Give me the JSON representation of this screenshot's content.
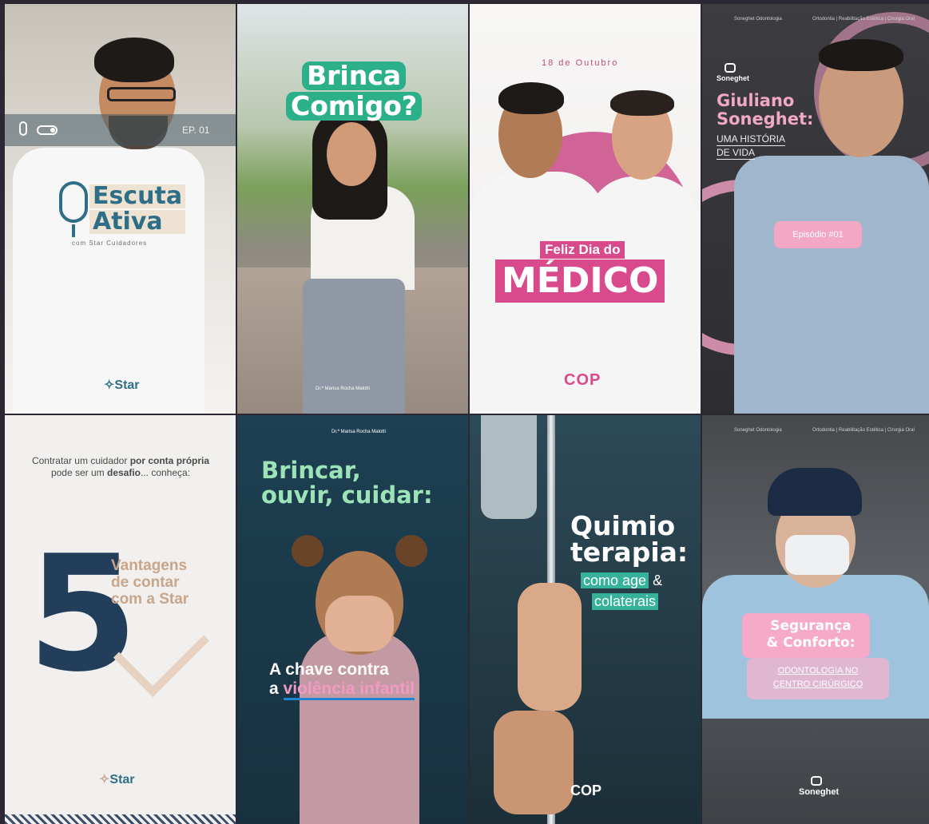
{
  "card1": {
    "ep": "EP. 01",
    "title_line1": "Escuta",
    "title_line2": "Ativa",
    "subtitle": "com Star Cuidadores",
    "logo": "Star"
  },
  "card2": {
    "title_line1": "Brinca",
    "title_line2": "Comigo?",
    "footer": "Dr.ª Marisa Rocha Malotti"
  },
  "card3": {
    "date": "18 de Outubro",
    "feliz": "Feliz Dia do",
    "medico": "MÉDICO",
    "logo": "COP"
  },
  "card4": {
    "nav_left": "Soneghet Odontologia",
    "nav_right": "Ortodontia | Reabilitação Estética | Cirurgia Oral",
    "brand": "Soneghet",
    "name_line1": "Giuliano",
    "name_line2": "Soneghet:",
    "hist_line1": "UMA HISTÓRIA",
    "hist_line2": "DE VIDA",
    "episode": "Episódio #01"
  },
  "card5": {
    "intro_part1": "Contratar um cuidador ",
    "intro_bold1": "por conta própria",
    "intro_part2": "pode ser um ",
    "intro_bold2": "desafio",
    "intro_part3": "... conheça:",
    "number": "5",
    "vant_line1": "Vantagens",
    "vant_line2": "de contar",
    "vant_line3": "com a Star",
    "logo": "Star"
  },
  "card6": {
    "header": "Dr.ª Marisa Rocha Malotti",
    "title_line1": "Brincar,",
    "title_line2": "ouvir, cuidar:",
    "chave_line1": "A chave contra",
    "chave_a": "a ",
    "chave_pink": "violência infantil"
  },
  "card7": {
    "title_line1": "Quimio",
    "title_line2": "terapia:",
    "como": "como age",
    "amp": " & ",
    "cola": "colaterais",
    "logo": "COP"
  },
  "card8": {
    "nav_left": "Soneghet Odontologia",
    "nav_right": "Ortodontia | Reabilitação Estética | Cirurgia Oral",
    "seg_line1": "Segurança",
    "seg_line2": "& Conforto:",
    "odo_line1": "ODONTOLOGIA NO",
    "odo_line2": "CENTRO CIRÚRGICO",
    "brand": "Soneghet"
  },
  "colors": {
    "star_blue": "#2e6e86",
    "green": "#2bb08a",
    "pink": "#d94a8c",
    "soft_pink": "#f3a7c5",
    "navy": "#223e5a",
    "teal": "#36b29a"
  }
}
